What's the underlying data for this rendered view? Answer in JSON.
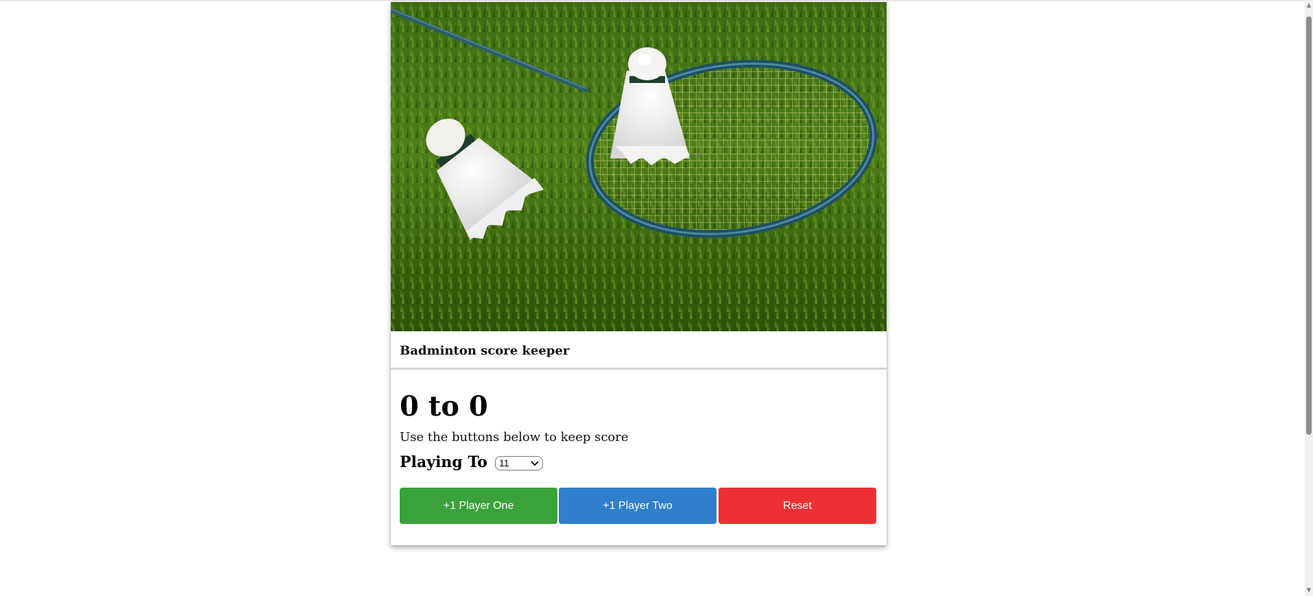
{
  "card": {
    "title": "Badminton score keeper",
    "image": {
      "subject": "badminton racket and shuttlecocks on grass"
    }
  },
  "score": {
    "player_one": 0,
    "player_two": 0,
    "display": "0 to 0"
  },
  "instructions": "Use the buttons below to keep score",
  "playing_to": {
    "label": "Playing To",
    "selected": "11"
  },
  "buttons": {
    "player_one_label": "+1 Player One",
    "player_two_label": "+1 Player Two",
    "reset_label": "Reset"
  },
  "colors": {
    "player_one": "#3aa23a",
    "player_two": "#2f7fcc",
    "reset": "#ec3034"
  },
  "icons": {
    "select_arrow": "chevron-down-icon",
    "scroll_up": "arrow-up-icon",
    "scroll_down": "arrow-down-icon"
  }
}
